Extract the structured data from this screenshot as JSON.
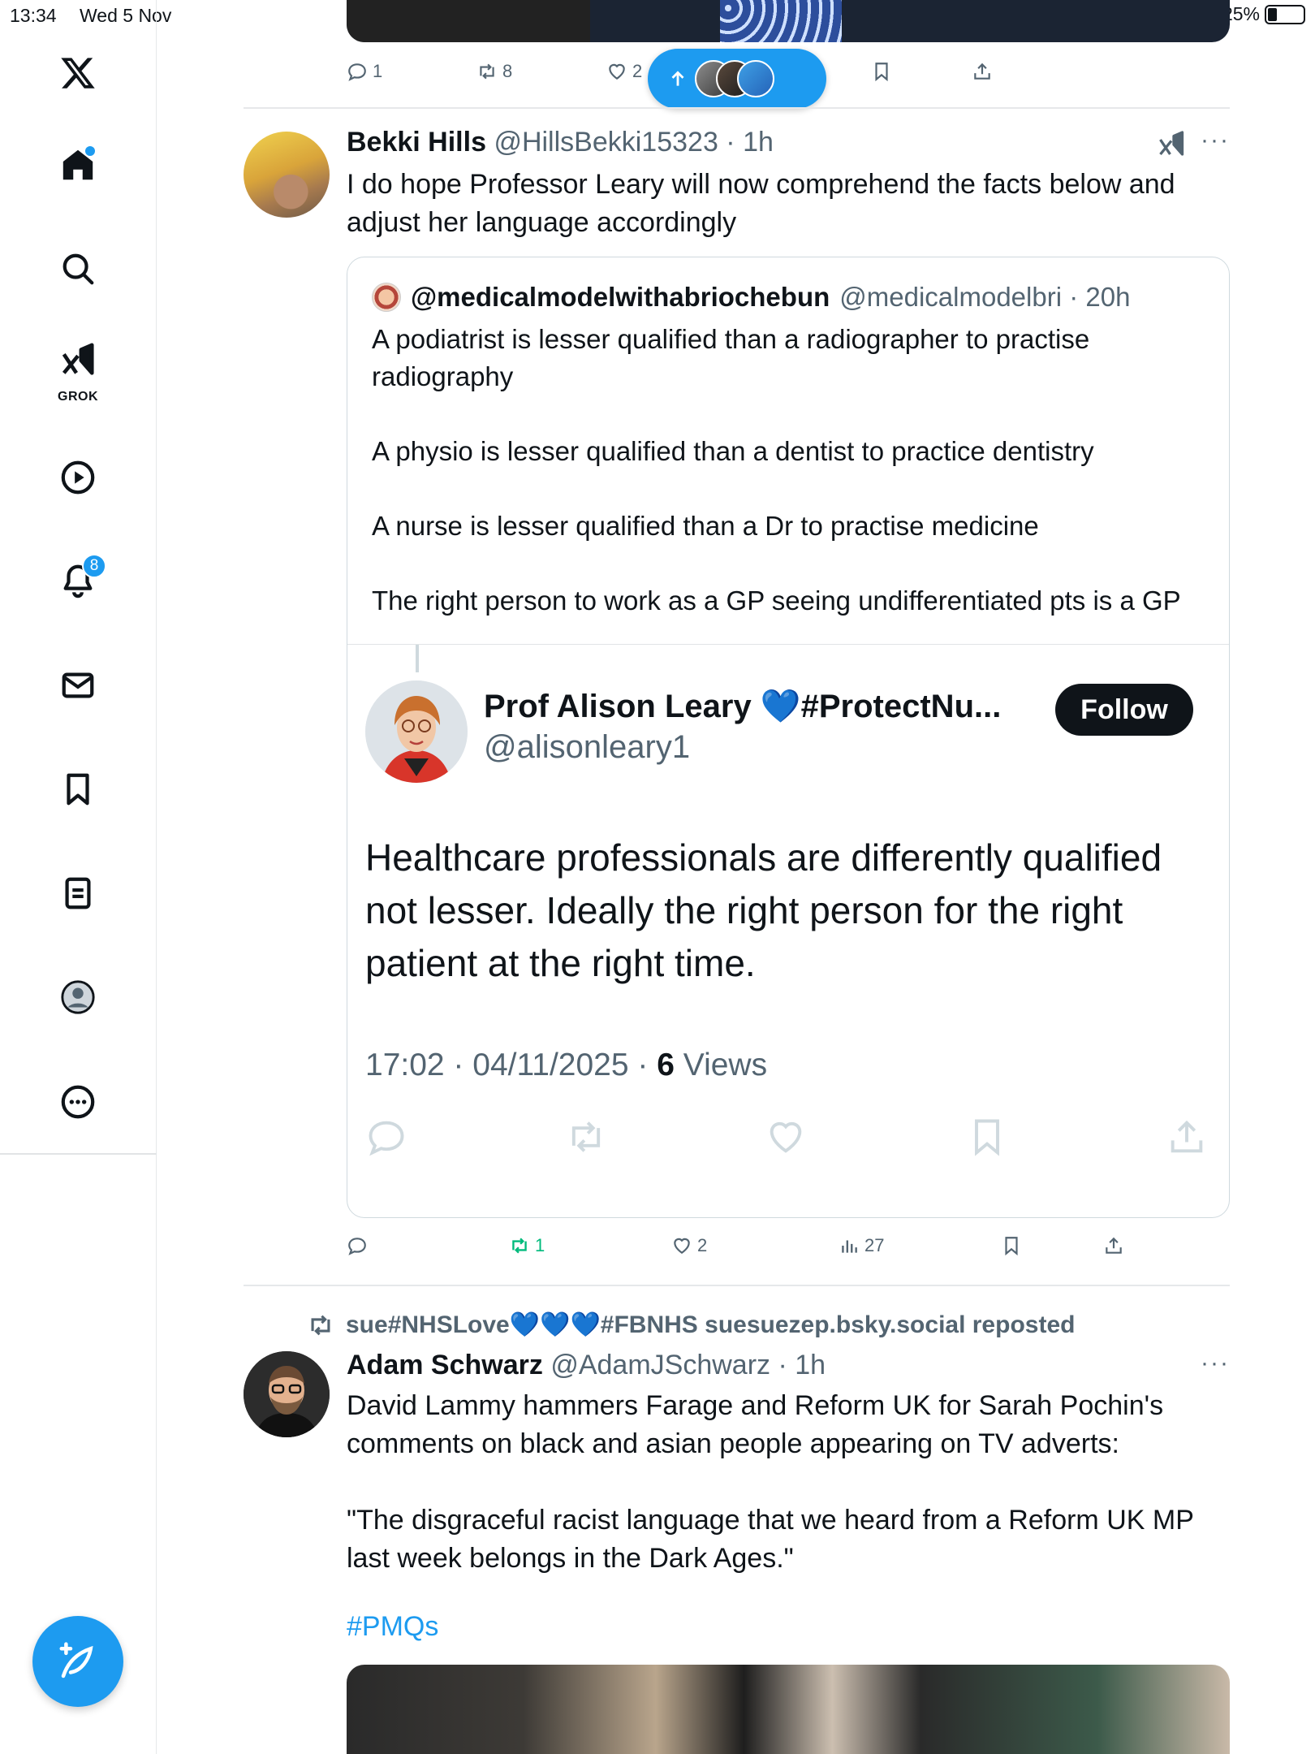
{
  "status_bar": {
    "time": "13:34",
    "date": "Wed 5 Nov",
    "battery": "25%",
    "battery_level": 0.25
  },
  "sidebar": {
    "logo": "x-logo-icon",
    "items": [
      {
        "name": "home",
        "icon": "home-icon"
      },
      {
        "name": "explore",
        "icon": "search-icon"
      },
      {
        "name": "grok",
        "icon": "grok-icon",
        "label": "GROK"
      },
      {
        "name": "video",
        "icon": "play-icon"
      },
      {
        "name": "notifications",
        "icon": "bell-icon",
        "badge": "8"
      },
      {
        "name": "messages",
        "icon": "mail-icon"
      },
      {
        "name": "bookmarks",
        "icon": "bookmark-icon"
      },
      {
        "name": "lists",
        "icon": "list-icon"
      },
      {
        "name": "profile",
        "icon": "profile-icon"
      },
      {
        "name": "more",
        "icon": "more-icon"
      }
    ],
    "compose": "compose-icon"
  },
  "previous_post": {
    "actions": {
      "replies": "1",
      "reposts": "8",
      "likes": "2"
    }
  },
  "new_posts_pill": {
    "icon": "arrow-up-icon"
  },
  "post1": {
    "name": "Bekki Hills",
    "handle": "@HillsBekki15323 · 1h",
    "text": "I do hope Professor Leary will now comprehend the facts below and adjust her language accordingly",
    "quote": {
      "name": "@medicalmodelwithabriochebun",
      "handle": "@medicalmodelbri · 20h",
      "text": "A podiatrist is lesser qualified than a radiographer to practise radiography\n\nA physio is lesser qualified than a dentist to practice dentistry\n\nA nurse is lesser qualified than a Dr to practise medicine\n\nThe right person to work as a GP seeing undifferentiated pts is a GP",
      "embed": {
        "name": "Prof Alison Leary 💙#ProtectNu...",
        "handle": "@alisonleary1",
        "follow": "Follow",
        "text": "Healthcare professionals are differently qualified not lesser.  Ideally the right person for the right patient at the right time.",
        "timestamp": "17:02 · 04/11/2025 · ",
        "views_count": "6",
        "views_label": " Views"
      }
    },
    "actions": {
      "replies": "",
      "reposts": "1",
      "likes": "2",
      "views": "27"
    }
  },
  "post2": {
    "repost_by": "sue#NHSLove💙💙💙#FBNHS suesuezep.bsky.social reposted",
    "name": "Adam Schwarz",
    "handle": "@AdamJSchwarz · 1h",
    "text": "David Lammy hammers Farage and Reform UK for Sarah Pochin's comments on black and asian people appearing on TV adverts:\n\n\"The disgraceful racist language that we heard from a Reform UK MP last week belongs in the Dark Ages.\"",
    "hashtag": "#PMQs"
  },
  "colors": {
    "accent": "#1d9bf0",
    "text": "#0f1419",
    "muted": "#536471",
    "repost_green": "#00ba7c",
    "border": "#cfd9de"
  }
}
